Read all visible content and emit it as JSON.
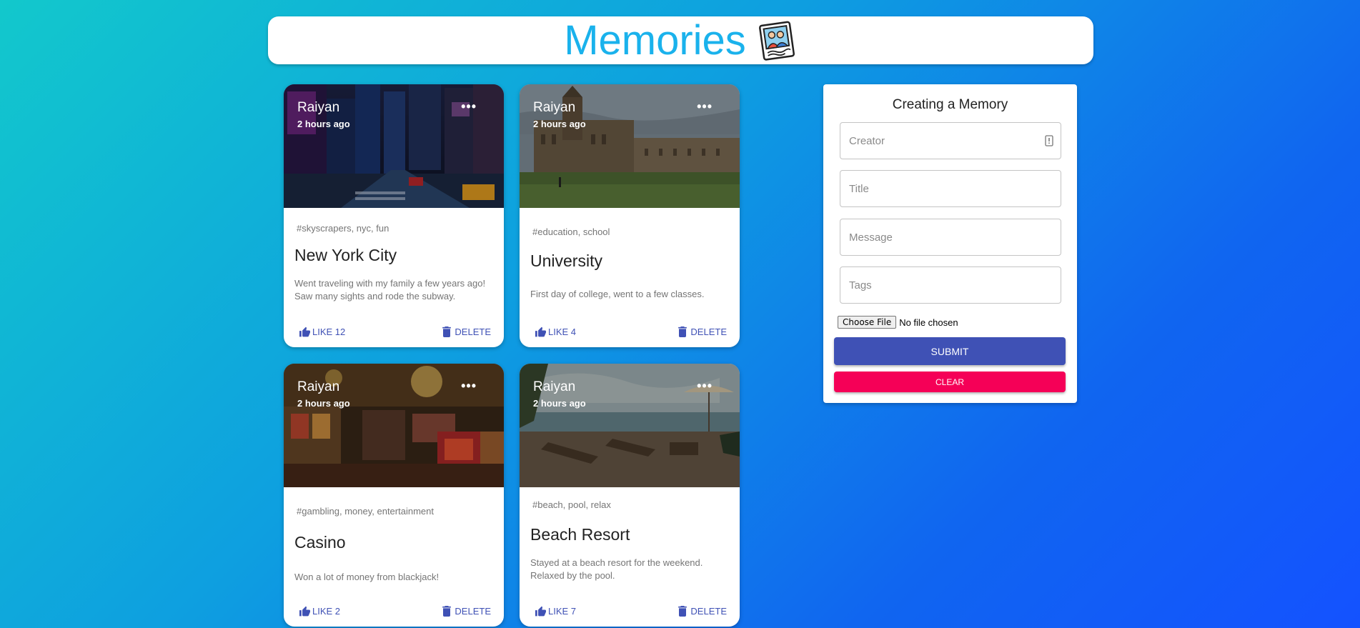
{
  "header": {
    "title": "Memories",
    "icon": "photo-memories-icon"
  },
  "posts": [
    {
      "creator": "Raiyan",
      "time": "2 hours ago",
      "tags": "#skyscrapers, nyc, fun",
      "title": "New York City",
      "message": "Went traveling with my family a few years ago! Saw many sights and rode the subway.",
      "like_label": "LIKE 12",
      "delete_label": "DELETE",
      "image": "city-night-street-photo"
    },
    {
      "creator": "Raiyan",
      "time": "2 hours ago",
      "tags": "#education, school",
      "title": "University",
      "message": "First day of college, went to a few classes.",
      "like_label": "LIKE 4",
      "delete_label": "DELETE",
      "image": "university-campus-photo"
    },
    {
      "creator": "Raiyan",
      "time": "2 hours ago",
      "tags": "#gambling, money, entertainment",
      "title": "Casino",
      "message": "Won a lot of money from blackjack!",
      "like_label": "LIKE 2",
      "delete_label": "DELETE",
      "image": "casino-floor-photo"
    },
    {
      "creator": "Raiyan",
      "time": "2 hours ago",
      "tags": "#beach, pool, relax",
      "title": "Beach Resort",
      "message": "Stayed at a beach resort for the weekend. Relaxed by the pool.",
      "like_label": "LIKE 7",
      "delete_label": "DELETE",
      "image": "beach-resort-photo"
    }
  ],
  "form": {
    "title": "Creating a Memory",
    "creator_placeholder": "Creator",
    "title_placeholder": "Title",
    "message_placeholder": "Message",
    "tags_placeholder": "Tags",
    "file_button": "Choose File",
    "file_status": "No file chosen",
    "submit_label": "SUBMIT",
    "clear_label": "CLEAR"
  },
  "colors": {
    "brand": "#1ab2ec",
    "primary": "#3f51b5",
    "secondary": "#f50057"
  }
}
